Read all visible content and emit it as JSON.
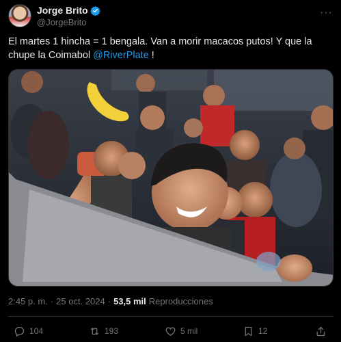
{
  "author": {
    "display_name": "Jorge Brito",
    "handle": "@JorgeBrito",
    "verified_icon": "verified-badge-icon",
    "more_label": "···"
  },
  "tweet": {
    "text_before": "El martes 1 hincha = 1 bengala. Van a morir macacos putos! Y que la chupe la Coimabol ",
    "mention": "@RiverPlate",
    "text_after": " !"
  },
  "meta": {
    "time": "2:45 p. m.",
    "separator": "·",
    "date": "25 oct. 2024",
    "views_count": "53,5 mil",
    "views_label": "Reproducciones"
  },
  "actions": {
    "replies": "104",
    "retweets": "193",
    "likes": "5 mil",
    "bookmarks": "12"
  },
  "colors": {
    "background": "#000000",
    "text": "#e7e9ea",
    "secondary": "#71767b",
    "accent": "#1d9bf0",
    "border": "#2f3336"
  }
}
